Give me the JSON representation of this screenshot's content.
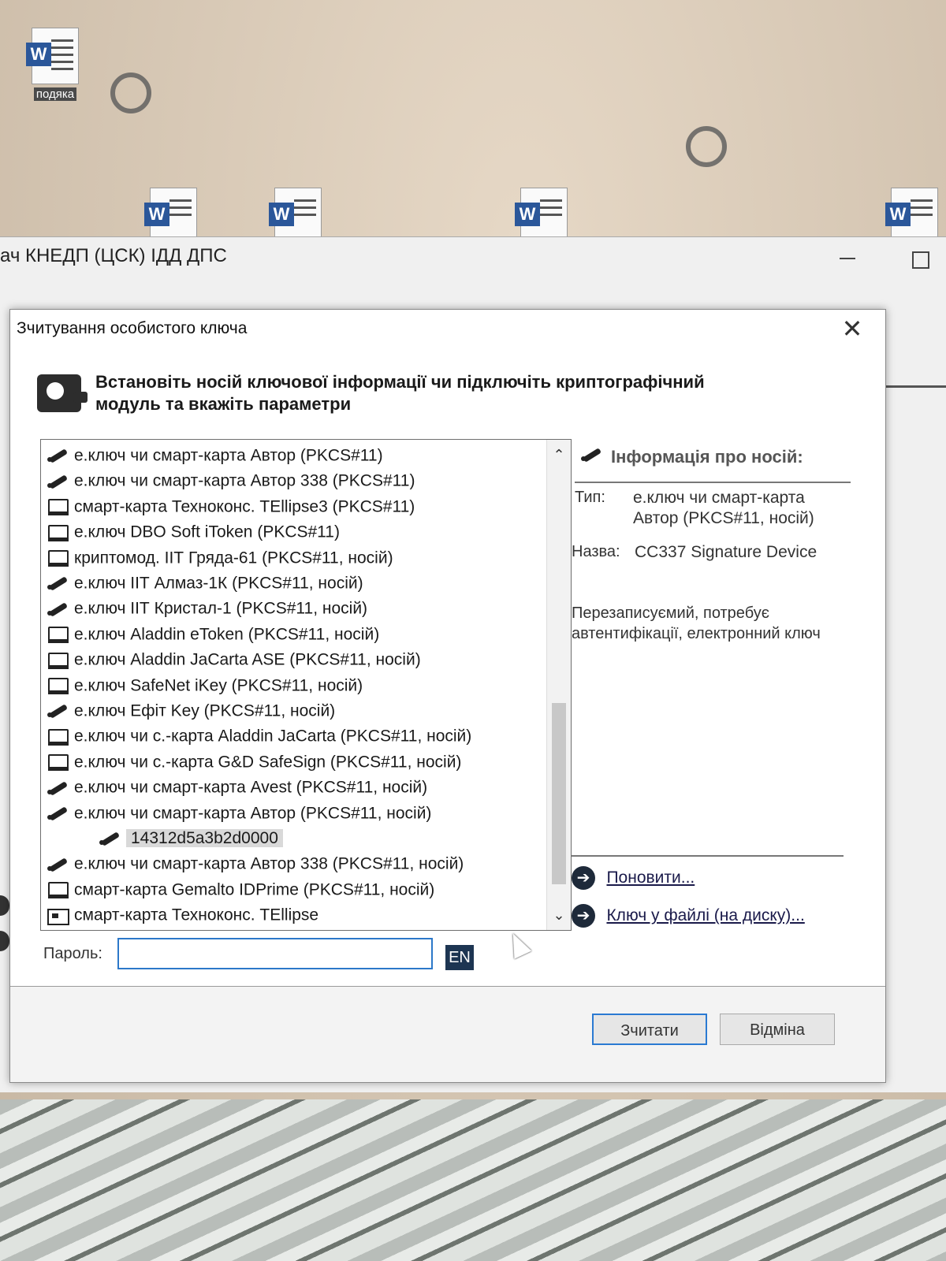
{
  "desktop": {
    "doc_icon_label": "подяка"
  },
  "app": {
    "title": "ач КНЕДП (ЦСК) ІДД ДПС"
  },
  "dialog": {
    "title": "Зчитування особистого ключа",
    "header_line1": "Встановіть носій ключової інформації чи підключіть криптографічний",
    "header_line2": "модуль та вкажіть параметри",
    "list_items": [
      {
        "icon": "pen-icon",
        "label": "е.ключ чи смарт-карта Автор (PKCS#11)"
      },
      {
        "icon": "pen-icon",
        "label": "е.ключ чи смарт-карта Автор 338 (PKCS#11)"
      },
      {
        "icon": "reader-icon",
        "label": "смарт-карта Техноконс. TEllipse3 (PKCS#11)"
      },
      {
        "icon": "reader-icon",
        "label": "е.ключ DBO Soft iToken (PKCS#11)"
      },
      {
        "icon": "reader-icon",
        "label": "криптомод. ІІТ Гряда-61 (PKCS#11, носій)"
      },
      {
        "icon": "pen-icon",
        "label": "е.ключ ІІТ Алмаз-1К (PKCS#11, носій)"
      },
      {
        "icon": "pen-icon",
        "label": "е.ключ ІІТ Кристал-1 (PKCS#11, носій)"
      },
      {
        "icon": "reader-icon",
        "label": "е.ключ Aladdin eToken (PKCS#11, носій)"
      },
      {
        "icon": "reader-icon",
        "label": "е.ключ Aladdin JaCarta ASE (PKCS#11, носій)"
      },
      {
        "icon": "reader-icon",
        "label": "е.ключ SafeNet iKey (PKCS#11, носій)"
      },
      {
        "icon": "pen-icon",
        "label": "е.ключ Ефіт Key (PKCS#11, носій)"
      },
      {
        "icon": "reader-icon",
        "label": "е.ключ чи с.-карта Aladdin JaCarta (PKCS#11, носій)"
      },
      {
        "icon": "reader-icon",
        "label": "е.ключ чи с.-карта G&D SafeSign (PKCS#11, носій)"
      },
      {
        "icon": "pen-icon",
        "label": "е.ключ чи смарт-карта Avest (PKCS#11, носій)"
      },
      {
        "icon": "pen-icon",
        "label": "е.ключ чи смарт-карта Автор (PKCS#11, носій)"
      },
      {
        "icon": "pen-icon",
        "label": "14312d5a3b2d0000",
        "child": true,
        "selected": true
      },
      {
        "icon": "pen-icon",
        "label": "е.ключ чи смарт-карта Автор 338 (PKCS#11, носій)"
      },
      {
        "icon": "reader-icon",
        "label": "смарт-карта Gemalto IDPrime (PKCS#11, носій)"
      },
      {
        "icon": "card-icon",
        "label": "смарт-карта Техноконс. TEllipse"
      }
    ],
    "info": {
      "title": "Інформація про носій:",
      "type_label": "Тип:",
      "type_value_line1": "е.ключ чи смарт-карта",
      "type_value_line2": "Автор (PKCS#11, носій)",
      "name_label": "Назва:",
      "name_value": "CC337 Signature Device",
      "description": "Перезаписуємий, потребує автентифікації, електронний ключ"
    },
    "links": {
      "refresh": "Поновити...",
      "file_key": "Ключ у файлі (на диску)..."
    },
    "password": {
      "label": "Пароль:",
      "value": "",
      "lang": "EN"
    },
    "buttons": {
      "read": "Зчитати",
      "cancel": "Відміна"
    }
  }
}
